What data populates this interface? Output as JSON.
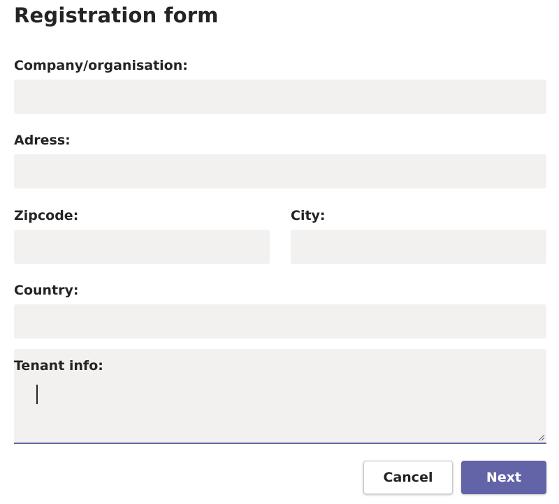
{
  "form": {
    "title": "Registration form",
    "fields": {
      "company": {
        "label": "Company/organisation:",
        "value": ""
      },
      "address": {
        "label": "Adress:",
        "value": ""
      },
      "zipcode": {
        "label": "Zipcode:",
        "value": ""
      },
      "city": {
        "label": "City:",
        "value": ""
      },
      "country": {
        "label": "Country:",
        "value": ""
      },
      "tenant_info": {
        "label": "Tenant info:",
        "value": "",
        "focused": true
      }
    },
    "buttons": {
      "cancel_label": "Cancel",
      "next_label": "Next"
    }
  },
  "colors": {
    "accent": "#6264a7",
    "input_background": "#f2f1f0",
    "text": "#252423"
  }
}
